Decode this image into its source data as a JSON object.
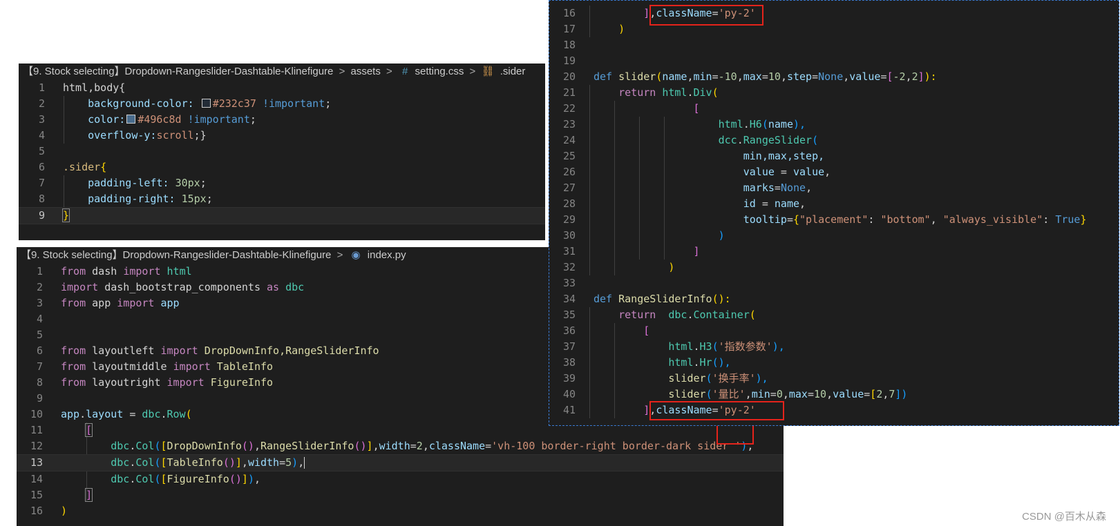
{
  "css_editor": {
    "breadcrumb": {
      "folder": "【9. Stock selecting】Dropdown-Rangeslider-Dashtable-Klinefigure",
      "subfolder": "assets",
      "file": "setting.css",
      "symbol": ".sider",
      "separator": ">",
      "hash_glyph": "#",
      "symbol_glyph": "⛓"
    },
    "line_numbers": [
      "1",
      "2",
      "3",
      "4",
      "5",
      "6",
      "7",
      "8",
      "9"
    ],
    "code": {
      "l1_sel": "html,body{",
      "l2_prop": "background-color:",
      "l2_val": "#232c37",
      "l2_imp": "!important",
      "l2_end": ";",
      "l3_prop": "color:",
      "l3_val": "#496c8d",
      "l3_imp": "!important",
      "l3_end": ";",
      "l4_prop": "overflow-y:",
      "l4_val": "scroll",
      "l4_end": ";}",
      "l6_sel": ".sider",
      "l6_brace": "{",
      "l7_prop": "padding-left:",
      "l7_val": "30px",
      "l7_end": ";",
      "l8_prop": "padding-right:",
      "l8_val": "15px",
      "l8_end": ";",
      "l9_brace": "}"
    },
    "swatch_colors": [
      "#232c37",
      "#496c8d"
    ]
  },
  "index_editor": {
    "breadcrumb": {
      "folder": "【9. Stock selecting】Dropdown-Rangeslider-Dashtable-Klinefigure",
      "file": "index.py",
      "separator": ">",
      "py_glyph": "◉"
    },
    "line_numbers": [
      "1",
      "2",
      "3",
      "4",
      "5",
      "6",
      "7",
      "8",
      "9",
      "10",
      "11",
      "12",
      "13",
      "14",
      "15",
      "16"
    ],
    "code": {
      "l1": [
        "from",
        "dash",
        "import",
        "html"
      ],
      "l2": [
        "import",
        "dash_bootstrap_components",
        "as",
        "dbc"
      ],
      "l3": [
        "from",
        "app",
        "import",
        "app"
      ],
      "l6": [
        "from",
        "layoutleft",
        "import",
        "DropDownInfo,RangeSliderInfo"
      ],
      "l7": [
        "from",
        "layoutmiddle",
        "import",
        "TableInfo"
      ],
      "l8": [
        "from",
        "layoutright",
        "import",
        "FigureInfo"
      ],
      "l10": [
        "app",
        ".",
        "layout",
        " = ",
        "dbc",
        ".",
        "Row",
        "("
      ],
      "l11": "[",
      "l12": [
        "dbc",
        ".",
        "Col",
        "(",
        "[",
        "DropDownInfo",
        "()",
        ",",
        "RangeSliderInfo",
        "()",
        "]",
        ",",
        "width",
        "=",
        "2",
        ",",
        "className",
        "=",
        "'vh-100 border-right border-dark ",
        "sider",
        " '",
        ")",
        ","
      ],
      "l13": [
        "dbc",
        ".",
        "Col",
        "(",
        "[",
        "TableInfo",
        "()",
        "]",
        ",",
        "width",
        "=",
        "5",
        ")",
        ","
      ],
      "l14": [
        "dbc",
        ".",
        "Col",
        "(",
        "[",
        "FigureInfo",
        "()",
        "]",
        ")",
        ","
      ],
      "l15": "]",
      "l16": ")"
    }
  },
  "right_editor": {
    "line_numbers": [
      "16",
      "17",
      "18",
      "19",
      "20",
      "21",
      "22",
      "23",
      "24",
      "25",
      "26",
      "27",
      "28",
      "29",
      "30",
      "31",
      "32",
      "33",
      "34",
      "35",
      "36",
      "37",
      "38",
      "39",
      "40",
      "41"
    ],
    "code": {
      "l16": [
        "]",
        ",",
        "className",
        "=",
        "'py-2'"
      ],
      "l17": ")",
      "l20": [
        "def",
        "slider",
        "(",
        "name",
        ",",
        "min",
        "=",
        "-10",
        ",",
        "max",
        "=",
        "10",
        ",",
        "step",
        "=",
        "None",
        ",",
        "value",
        "=",
        "[",
        "-2",
        ",",
        "2",
        "]",
        "):"
      ],
      "l21": [
        "return",
        "html",
        ".",
        "Div",
        "("
      ],
      "l22": "[",
      "l23": [
        "html",
        ".",
        "H6",
        "(",
        "name",
        "),"
      ],
      "l24": [
        "dcc",
        ".",
        "RangeSlider",
        "("
      ],
      "l25": "min,max,step,",
      "l26": [
        "value",
        " = ",
        "value",
        ","
      ],
      "l27": [
        "marks",
        "=",
        "None",
        ","
      ],
      "l28": [
        "id",
        " = ",
        "name",
        ","
      ],
      "l29": [
        "tooltip",
        "=",
        "{",
        "\"placement\"",
        ": ",
        "\"bottom\"",
        ", ",
        "\"always_visible\"",
        ": ",
        "True",
        "}"
      ],
      "l30": ")",
      "l31": "]",
      "l32": ")",
      "l34": [
        "def",
        "RangeSliderInfo",
        "():"
      ],
      "l35": [
        "return",
        "dbc",
        ".",
        "Container",
        "("
      ],
      "l36": "[",
      "l37": [
        "html",
        ".",
        "H3",
        "(",
        "'指数参数'",
        "),"
      ],
      "l38": [
        "html",
        ".",
        "Hr",
        "(),"
      ],
      "l39": [
        "slider",
        "(",
        "'换手率'",
        "),"
      ],
      "l40": [
        "slider",
        "(",
        "'量比'",
        ",",
        "min",
        "=",
        "0",
        ",",
        "max",
        "=",
        "10",
        ",",
        "value",
        "=",
        "[",
        "2",
        ",",
        "7",
        "])"
      ],
      "l41": [
        "]",
        ",",
        "className",
        "=",
        "'py-2'"
      ]
    }
  },
  "watermark": "CSDN @百木从森",
  "colors": {
    "editor_bg": "#1e1e1e",
    "annotation_red": "#e5231b",
    "keyword": "#c586c0",
    "string": "#ce9178"
  }
}
